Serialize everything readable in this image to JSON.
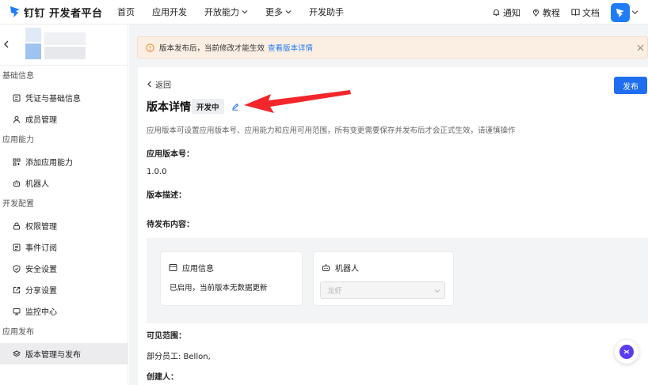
{
  "header": {
    "logo_text": "钉钉 开发者平台",
    "nav": [
      {
        "label": "首页"
      },
      {
        "label": "应用开发"
      },
      {
        "label": "开放能力"
      },
      {
        "label": "更多"
      },
      {
        "label": "开发助手"
      }
    ],
    "tools": {
      "notify": "通知",
      "tutorial": "教程",
      "docs": "文档"
    }
  },
  "sidebar": {
    "sections": [
      {
        "label": "基础信息",
        "items": [
          {
            "label": "凭证与基础信息",
            "icon": "credential-icon"
          },
          {
            "label": "成员管理",
            "icon": "user-icon"
          }
        ]
      },
      {
        "label": "应用能力",
        "items": [
          {
            "label": "添加应用能力",
            "icon": "grid-add-icon"
          },
          {
            "label": "机器人",
            "icon": "robot-icon"
          }
        ]
      },
      {
        "label": "开发配置",
        "items": [
          {
            "label": "权限管理",
            "icon": "lock-icon"
          },
          {
            "label": "事件订阅",
            "icon": "event-icon"
          },
          {
            "label": "安全设置",
            "icon": "shield-icon"
          },
          {
            "label": "分享设置",
            "icon": "share-icon"
          },
          {
            "label": "监控中心",
            "icon": "monitor-icon"
          }
        ]
      },
      {
        "label": "应用发布",
        "items": [
          {
            "label": "版本管理与发布",
            "icon": "layers-icon",
            "active": true
          }
        ]
      }
    ]
  },
  "notice": {
    "text": "版本发布后，当前修改才能生效",
    "link": "查看版本详情"
  },
  "page": {
    "back": "返回",
    "publish": "发布",
    "title": "版本详情",
    "status": "开发中",
    "description": "应用版本可设置应用版本号、应用能力和应用可用范围，所有变更需要保存并发布后才会正式生效，请谨慎操作",
    "version_label": "应用版本号：",
    "version_value": "1.0.0",
    "desc_label": "版本描述：",
    "pending_label": "待发布内容：",
    "card_app": {
      "title": "应用信息",
      "text": "已启用，当前版本无数据更新"
    },
    "card_robot": {
      "title": "机器人",
      "select_value": "龙虾"
    },
    "scope_label": "可见范围：",
    "scope_value": "部分员工: Bellon,",
    "creator_label": "创建人："
  },
  "colors": {
    "accent": "#1f6ef0",
    "notice_bg": "#fbeee3",
    "arrow": "#f2262b"
  }
}
